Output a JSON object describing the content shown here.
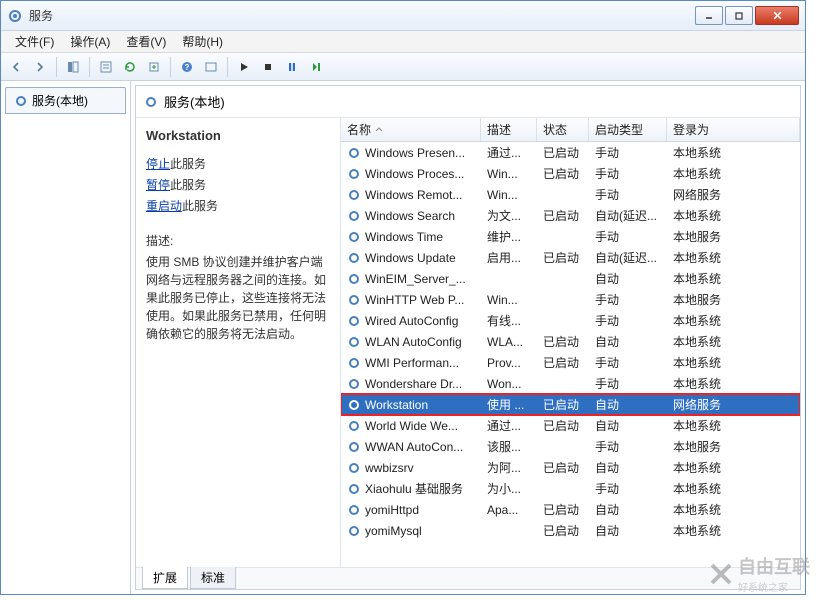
{
  "window": {
    "title": "服务"
  },
  "menu": {
    "file": "文件(F)",
    "action": "操作(A)",
    "view": "查看(V)",
    "help": "帮助(H)"
  },
  "left": {
    "tab": "服务(本地)"
  },
  "header": {
    "title": "服务(本地)"
  },
  "detail": {
    "name": "Workstation",
    "stop": "停止",
    "pause": "暂停",
    "restart": "重启动",
    "suffix": "此服务",
    "desc_label": "描述:",
    "desc_text": "使用 SMB 协议创建并维护客户端网络与远程服务器之间的连接。如果此服务已停止，这些连接将无法使用。如果此服务已禁用，任何明确依赖它的服务将无法启动。"
  },
  "columns": {
    "name": "名称",
    "desc": "描述",
    "status": "状态",
    "startup": "启动类型",
    "logon": "登录为"
  },
  "services": [
    {
      "name": "Windows Presen...",
      "desc": "通过...",
      "status": "已启动",
      "startup": "手动",
      "logon": "本地系统"
    },
    {
      "name": "Windows Proces...",
      "desc": "Win...",
      "status": "已启动",
      "startup": "手动",
      "logon": "本地系统"
    },
    {
      "name": "Windows Remot...",
      "desc": "Win...",
      "status": "",
      "startup": "手动",
      "logon": "网络服务"
    },
    {
      "name": "Windows Search",
      "desc": "为文...",
      "status": "已启动",
      "startup": "自动(延迟...",
      "logon": "本地系统"
    },
    {
      "name": "Windows Time",
      "desc": "维护...",
      "status": "",
      "startup": "手动",
      "logon": "本地服务"
    },
    {
      "name": "Windows Update",
      "desc": "启用...",
      "status": "已启动",
      "startup": "自动(延迟...",
      "logon": "本地系统"
    },
    {
      "name": "WinEIM_Server_...",
      "desc": "",
      "status": "",
      "startup": "自动",
      "logon": "本地系统"
    },
    {
      "name": "WinHTTP Web P...",
      "desc": "Win...",
      "status": "",
      "startup": "手动",
      "logon": "本地服务"
    },
    {
      "name": "Wired AutoConfig",
      "desc": "有线...",
      "status": "",
      "startup": "手动",
      "logon": "本地系统"
    },
    {
      "name": "WLAN AutoConfig",
      "desc": "WLA...",
      "status": "已启动",
      "startup": "自动",
      "logon": "本地系统"
    },
    {
      "name": "WMI Performan...",
      "desc": "Prov...",
      "status": "已启动",
      "startup": "手动",
      "logon": "本地系统"
    },
    {
      "name": "Wondershare Dr...",
      "desc": "Won...",
      "status": "",
      "startup": "手动",
      "logon": "本地系统"
    },
    {
      "name": "Workstation",
      "desc": "使用 ...",
      "status": "已启动",
      "startup": "自动",
      "logon": "网络服务",
      "selected": true
    },
    {
      "name": "World Wide We...",
      "desc": "通过...",
      "status": "已启动",
      "startup": "自动",
      "logon": "本地系统"
    },
    {
      "name": "WWAN AutoCon...",
      "desc": "该服...",
      "status": "",
      "startup": "手动",
      "logon": "本地服务"
    },
    {
      "name": "wwbizsrv",
      "desc": "为阿...",
      "status": "已启动",
      "startup": "自动",
      "logon": "本地系统"
    },
    {
      "name": "Xiaohulu 基础服务",
      "desc": "为小...",
      "status": "",
      "startup": "手动",
      "logon": "本地系统"
    },
    {
      "name": "yomiHttpd",
      "desc": "Apa...",
      "status": "已启动",
      "startup": "自动",
      "logon": "本地系统"
    },
    {
      "name": "yomiMysql",
      "desc": "",
      "status": "已启动",
      "startup": "自动",
      "logon": "本地系统"
    }
  ],
  "tabs": {
    "extended": "扩展",
    "standard": "标准"
  },
  "watermark": {
    "main": "自由互联",
    "sub": "好系统之家"
  }
}
